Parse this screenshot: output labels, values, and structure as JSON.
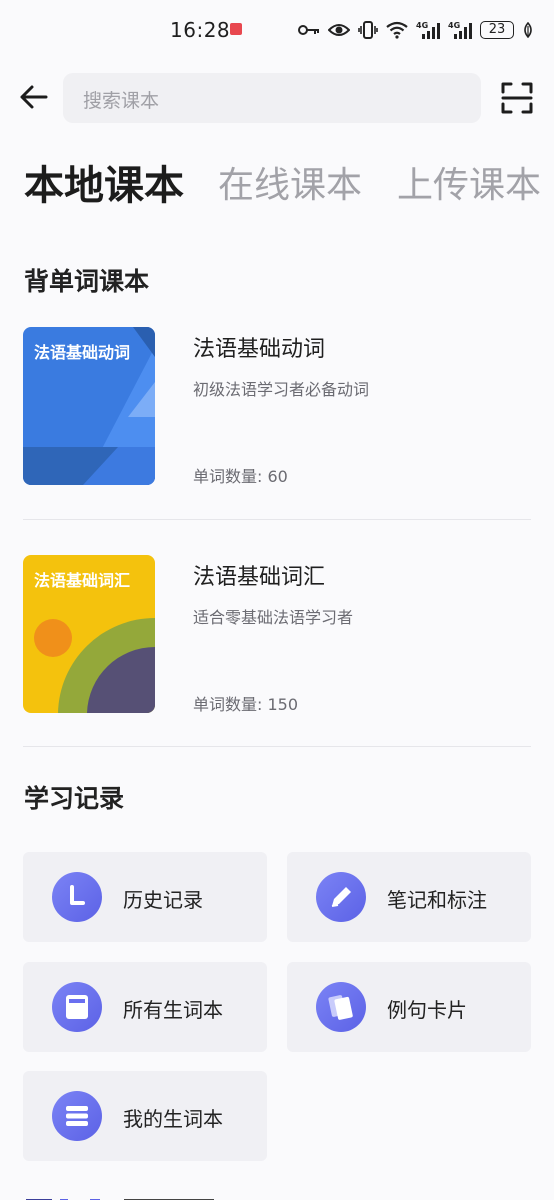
{
  "status_bar": {
    "time": "16:28",
    "battery": "23",
    "network_1": "4G",
    "network_2": "4G"
  },
  "search": {
    "placeholder": "搜索课本"
  },
  "tabs": [
    {
      "label": "本地课本",
      "active": true
    },
    {
      "label": "在线课本",
      "active": false
    },
    {
      "label": "上传课本",
      "active": false
    }
  ],
  "sections": {
    "vocab_books_title": "背单词课本",
    "study_records_title": "学习记录"
  },
  "books": [
    {
      "cover_title": "法语基础动词",
      "name": "法语基础动词",
      "description": "初级法语学习者必备动词",
      "count": "单词数量: 60",
      "cover_color": "#3a7be0"
    },
    {
      "cover_title": "法语基础词汇",
      "name": "法语基础词汇",
      "description": "适合零基础法语学习者",
      "count": "单词数量: 150",
      "cover_color": "#f4c20d"
    }
  ],
  "records": [
    {
      "label": "历史记录",
      "icon": "clock-icon"
    },
    {
      "label": "笔记和标注",
      "icon": "pencil-icon"
    },
    {
      "label": "所有生词本",
      "icon": "notebook-icon"
    },
    {
      "label": "例句卡片",
      "icon": "cards-icon"
    },
    {
      "label": "我的生词本",
      "icon": "list-icon"
    }
  ],
  "colors": {
    "accent": "#6a6ff0",
    "background": "#fafafc",
    "card": "#f0f0f4",
    "notification": "#e8474f"
  }
}
